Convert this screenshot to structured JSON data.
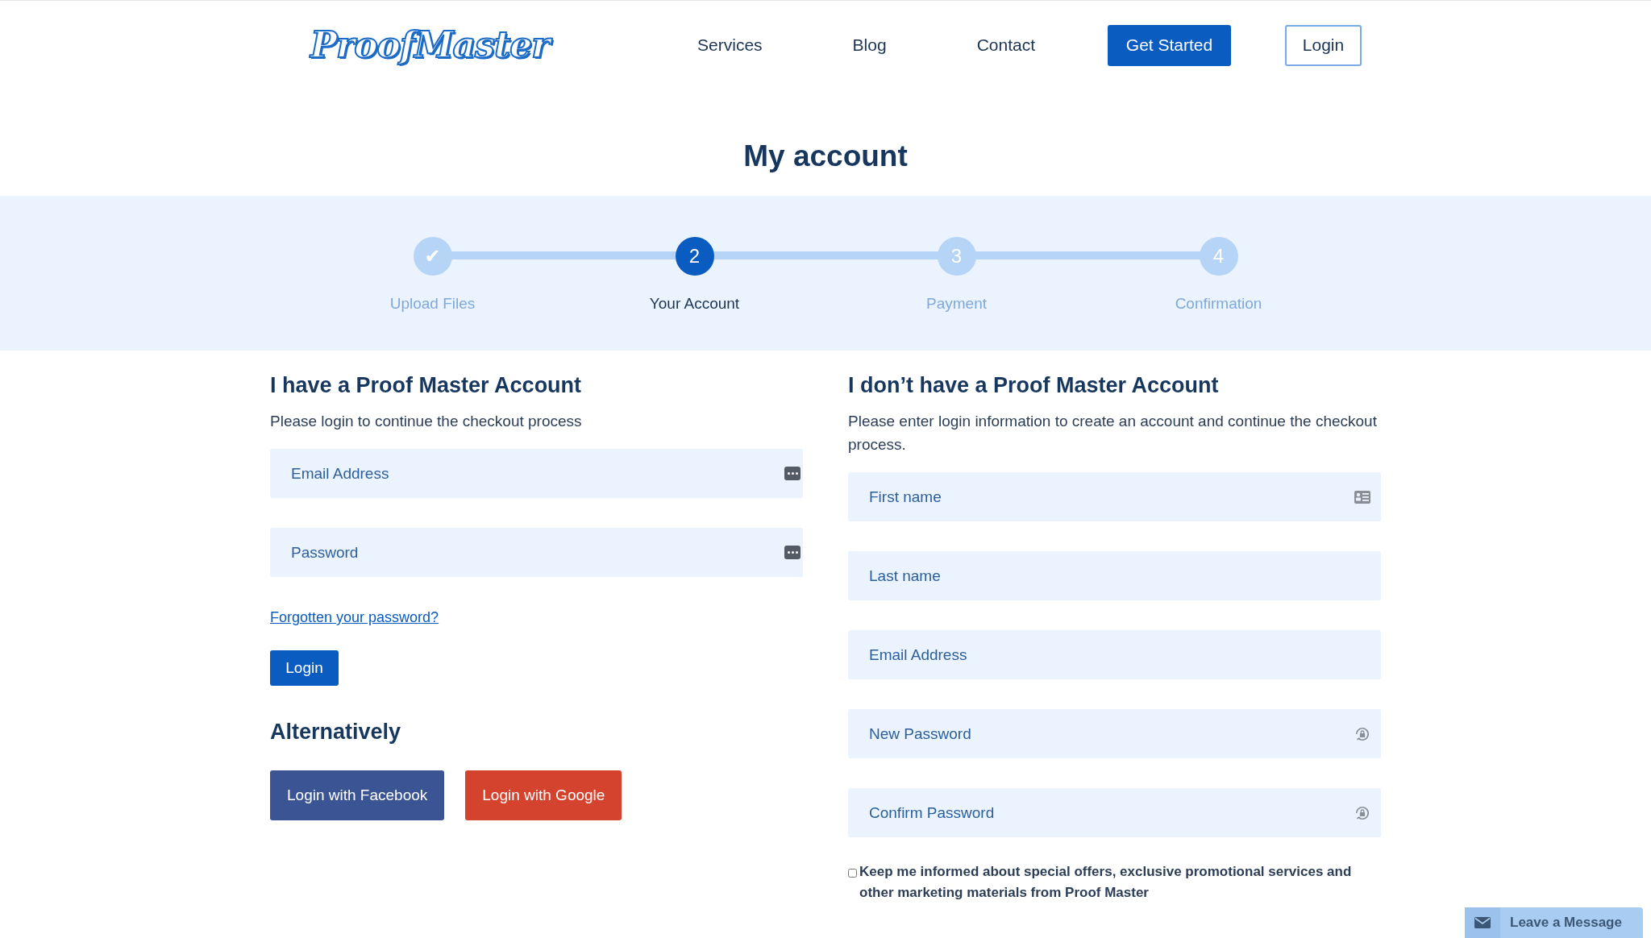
{
  "header": {
    "logo": "ProofMaster",
    "nav": [
      "Services",
      "Blog",
      "Contact"
    ],
    "cta": "Get Started",
    "login": "Login"
  },
  "title": "My account",
  "steps": [
    {
      "label": "Upload Files",
      "selected": false,
      "mark": "✔"
    },
    {
      "label": "Your Account",
      "selected": true,
      "mark": "2"
    },
    {
      "label": "Payment",
      "selected": false,
      "mark": "3"
    },
    {
      "label": "Confirmation",
      "selected": false,
      "mark": "4"
    }
  ],
  "login_panel": {
    "heading": "I have a Proof Master Account",
    "intro": "Please login to continue the checkout process",
    "fields": [
      {
        "placeholder": "Email Address",
        "kind": "autofill"
      },
      {
        "placeholder": "Password",
        "kind": "autofill"
      }
    ],
    "forgot_link": "Forgotten your password?",
    "login_button": "Login",
    "alt_heading": "Alternatively",
    "social": [
      {
        "label": "Login with Facebook",
        "kind": "facebook"
      },
      {
        "label": "Login with Google",
        "kind": "google"
      }
    ]
  },
  "register_panel": {
    "heading": "I don’t have a Proof Master Account",
    "intro": "Please enter login information to create an account and continue the checkout process.",
    "fields": [
      {
        "placeholder": "First name",
        "kind": "contact"
      },
      {
        "placeholder": "Last name",
        "kind": "plain"
      },
      {
        "placeholder": "Email Address",
        "kind": "plain"
      },
      {
        "placeholder": "New Password",
        "kind": "password"
      },
      {
        "placeholder": "Confirm Password",
        "kind": "password"
      }
    ],
    "newsletter": {
      "label": "Keep me informed about special offers, exclusive promotional services and other marketing materials from Proof Master",
      "checked": false
    }
  },
  "chat_widget": {
    "label": "Leave a Message"
  }
}
